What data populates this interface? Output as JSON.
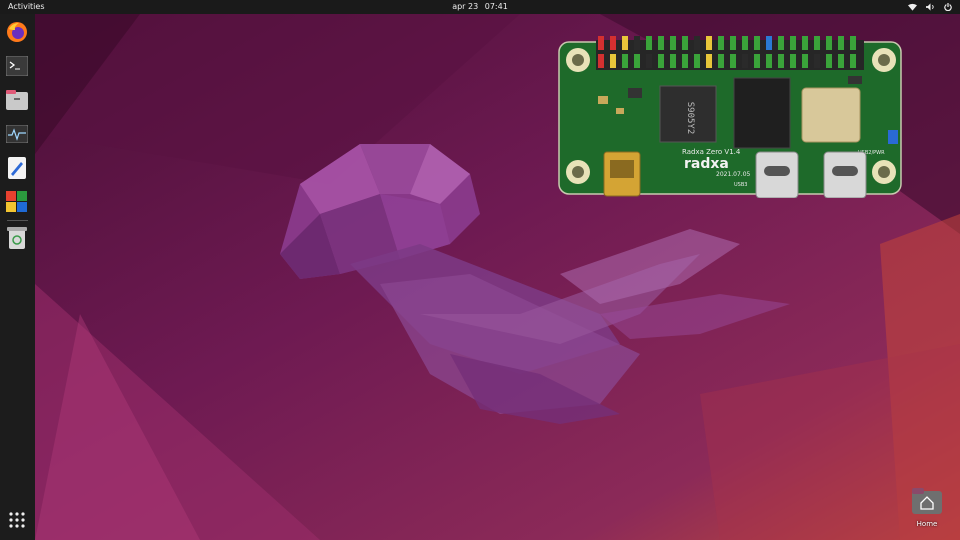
{
  "topbar": {
    "activities_label": "Activities",
    "date": "apr 23",
    "time": "07:41",
    "icons": [
      "wifi-icon",
      "speaker-icon",
      "power-icon"
    ]
  },
  "dock": {
    "apps": [
      "firefox-icon",
      "terminal-icon",
      "files-icon",
      "system-monitor-icon",
      "text-editor-icon",
      "software-icon",
      "trash-icon"
    ],
    "show_apps_icon": "show-applications-icon"
  },
  "board": {
    "model_label": "Radxa Zero V1.4",
    "brand_label": "radxa",
    "date_label": "2021.07.05",
    "chip_label": "S905Y2",
    "usb3_label": "USB3",
    "usb2_label": "USB2/PWR"
  },
  "desktop": {
    "home_label": "Home"
  },
  "colors": {
    "topbar_bg": "#1a1a1a",
    "dock_bg": "#1c1c1c",
    "wallpaper_main": "#7a1f5c",
    "pcb_green": "#1e6a2a"
  }
}
